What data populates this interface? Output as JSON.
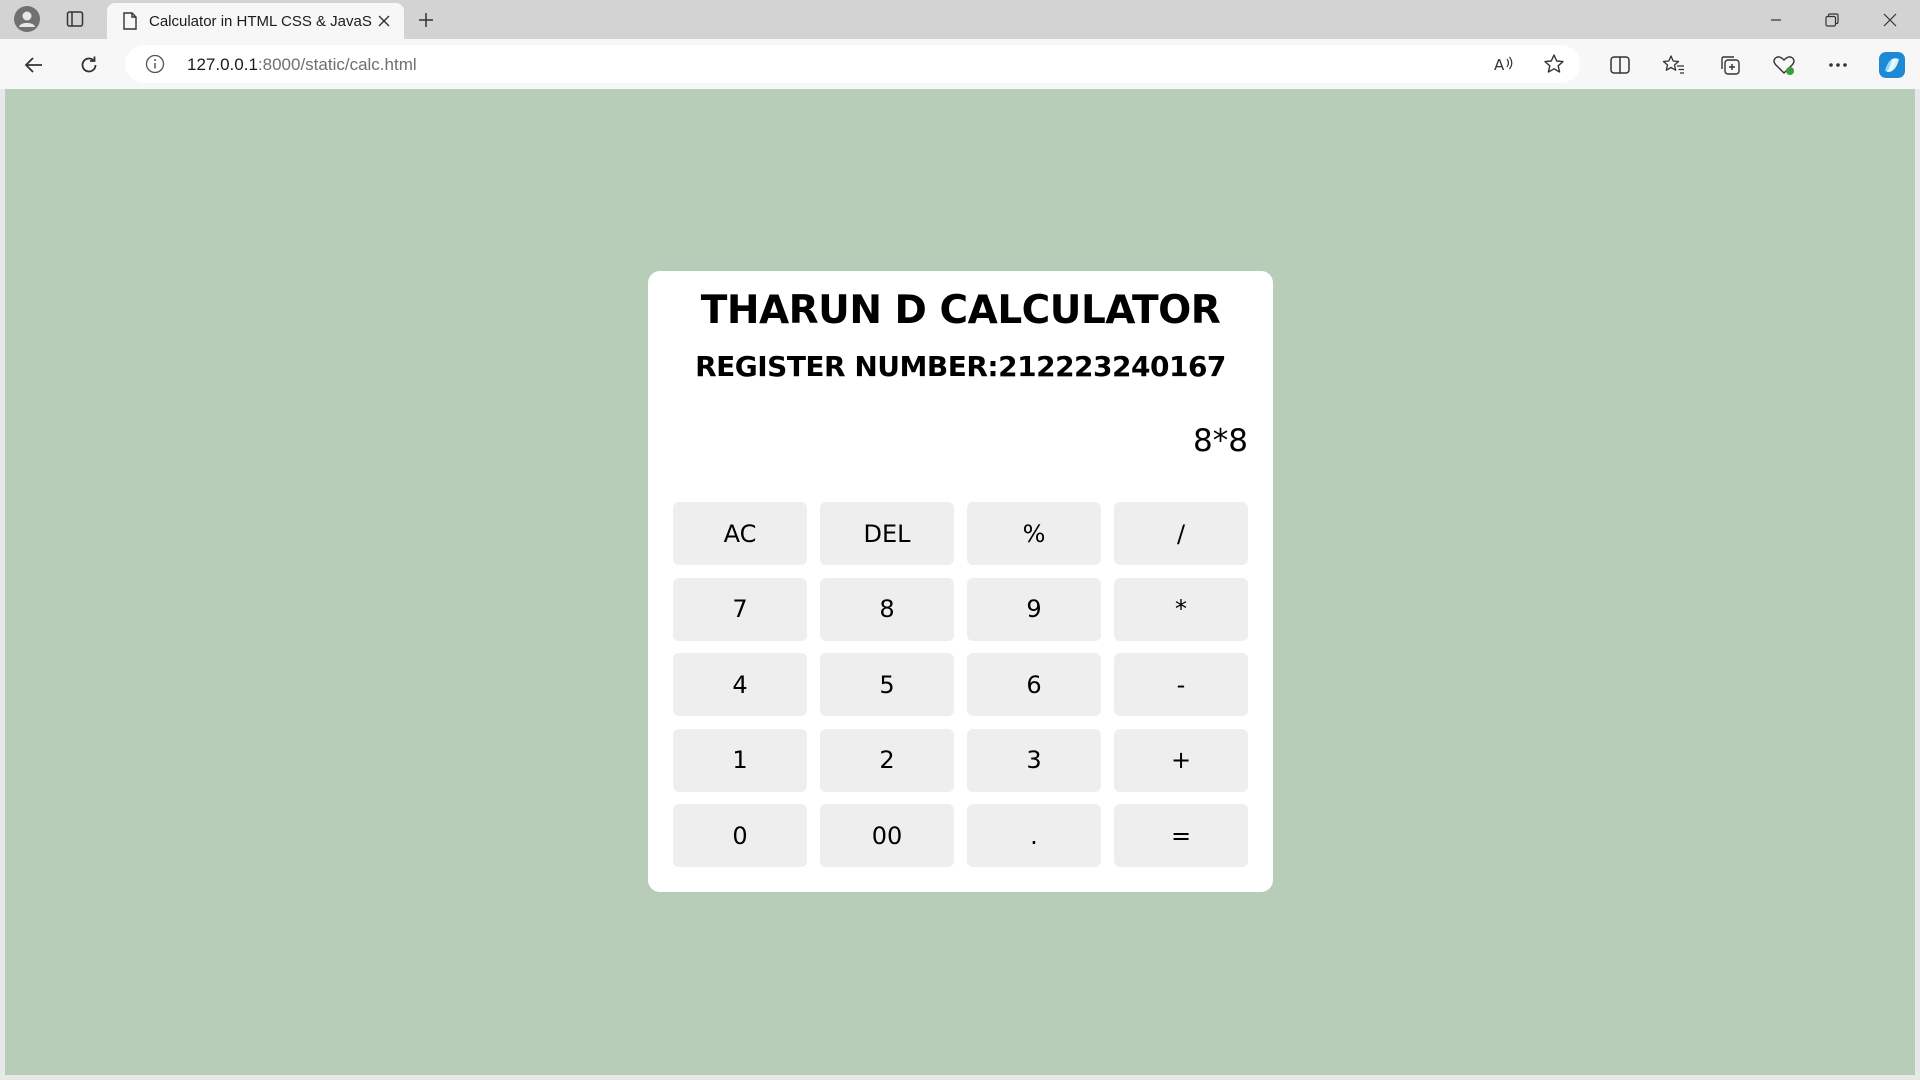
{
  "browser": {
    "tab_title": "Calculator in HTML CSS & JavaScript",
    "url_host": "127.0.0.1",
    "url_rest": ":8000/static/calc.html",
    "new_tab_label": "+"
  },
  "calculator": {
    "title": "THARUN D CALCULATOR",
    "subtitle": "REGISTER NUMBER:212223240167",
    "display_value": "8*8",
    "keys": [
      {
        "label": "AC",
        "name": "ac-button"
      },
      {
        "label": "DEL",
        "name": "del-button"
      },
      {
        "label": "%",
        "name": "percent-button"
      },
      {
        "label": "/",
        "name": "divide-button"
      },
      {
        "label": "7",
        "name": "seven-button"
      },
      {
        "label": "8",
        "name": "eight-button"
      },
      {
        "label": "9",
        "name": "nine-button"
      },
      {
        "label": "*",
        "name": "multiply-button"
      },
      {
        "label": "4",
        "name": "four-button"
      },
      {
        "label": "5",
        "name": "five-button"
      },
      {
        "label": "6",
        "name": "six-button"
      },
      {
        "label": "-",
        "name": "minus-button"
      },
      {
        "label": "1",
        "name": "one-button"
      },
      {
        "label": "2",
        "name": "two-button"
      },
      {
        "label": "3",
        "name": "three-button"
      },
      {
        "label": "+",
        "name": "plus-button"
      },
      {
        "label": "0",
        "name": "zero-button"
      },
      {
        "label": "00",
        "name": "double-zero-button"
      },
      {
        "label": ".",
        "name": "decimal-button"
      },
      {
        "label": "=",
        "name": "equals-button"
      }
    ]
  },
  "colors": {
    "page_background": "#b8cdb8",
    "card_background": "#ffffff",
    "key_background": "#eeeeee"
  }
}
